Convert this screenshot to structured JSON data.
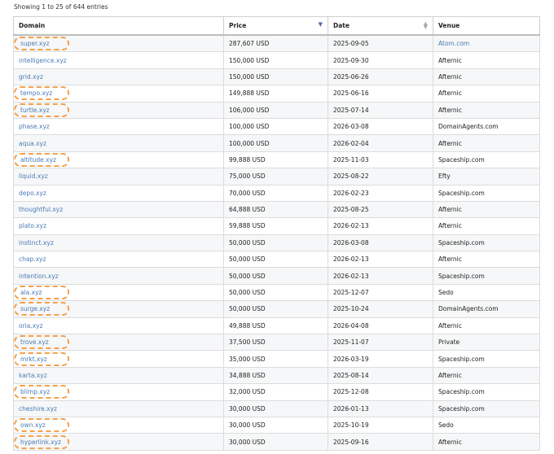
{
  "info": "Showing 1 to 25 of 644 entries",
  "columns": [
    "Domain",
    "Price",
    "Date",
    "Venue"
  ],
  "sort": {
    "column": "Price",
    "direction": "descending"
  },
  "rows": [
    {
      "domain": "super.xyz",
      "price": "287,607 USD",
      "date": "2025-09-05",
      "venue": "Atom.com",
      "venue_link": true,
      "highlighted": true
    },
    {
      "domain": "intelligence.xyz",
      "price": "150,000 USD",
      "date": "2025-09-30",
      "venue": "Afternic",
      "venue_link": false,
      "highlighted": false
    },
    {
      "domain": "grid.xyz",
      "price": "150,000 USD",
      "date": "2025-06-26",
      "venue": "Afternic",
      "venue_link": false,
      "highlighted": false
    },
    {
      "domain": "tempo.xyz",
      "price": "149,888 USD",
      "date": "2025-06-16",
      "venue": "Afternic",
      "venue_link": false,
      "highlighted": true
    },
    {
      "domain": "turtle.xyz",
      "price": "106,000 USD",
      "date": "2025-07-14",
      "venue": "Afternic",
      "venue_link": false,
      "highlighted": true
    },
    {
      "domain": "phase.xyz",
      "price": "100,000 USD",
      "date": "2026-03-08",
      "venue": "DomainAgents.com",
      "venue_link": false,
      "highlighted": false
    },
    {
      "domain": "aqua.xyz",
      "price": "100,000 USD",
      "date": "2026-02-04",
      "venue": "Afternic",
      "venue_link": false,
      "highlighted": false
    },
    {
      "domain": "altitude.xyz",
      "price": "99,888 USD",
      "date": "2025-11-03",
      "venue": "Spaceship.com",
      "venue_link": false,
      "highlighted": true
    },
    {
      "domain": "liquid.xyz",
      "price": "75,000 USD",
      "date": "2025-08-22",
      "venue": "Efty",
      "venue_link": false,
      "highlighted": false
    },
    {
      "domain": "depo.xyz",
      "price": "70,000 USD",
      "date": "2026-02-23",
      "venue": "Spaceship.com",
      "venue_link": false,
      "highlighted": false
    },
    {
      "domain": "thoughtful.xyz",
      "price": "64,888 USD",
      "date": "2025-08-25",
      "venue": "Afternic",
      "venue_link": false,
      "highlighted": false
    },
    {
      "domain": "plato.xyz",
      "price": "59,888 USD",
      "date": "2026-02-13",
      "venue": "Afternic",
      "venue_link": false,
      "highlighted": false
    },
    {
      "domain": "instinct.xyz",
      "price": "50,000 USD",
      "date": "2026-03-08",
      "venue": "Spaceship.com",
      "venue_link": false,
      "highlighted": false
    },
    {
      "domain": "chap.xyz",
      "price": "50,000 USD",
      "date": "2026-02-13",
      "venue": "Afternic",
      "venue_link": false,
      "highlighted": false
    },
    {
      "domain": "intention.xyz",
      "price": "50,000 USD",
      "date": "2026-02-13",
      "venue": "Spaceship.com",
      "venue_link": false,
      "highlighted": false
    },
    {
      "domain": "ala.xyz",
      "price": "50,000 USD",
      "date": "2025-12-07",
      "venue": "Sedo",
      "venue_link": false,
      "highlighted": true
    },
    {
      "domain": "surge.xyz",
      "price": "50,000 USD",
      "date": "2025-10-24",
      "venue": "DomainAgents.com",
      "venue_link": false,
      "highlighted": true
    },
    {
      "domain": "oria.xyz",
      "price": "49,888 USD",
      "date": "2026-04-08",
      "venue": "Afternic",
      "venue_link": false,
      "highlighted": false
    },
    {
      "domain": "trove.xyz",
      "price": "37,500 USD",
      "date": "2025-11-07",
      "venue": "Private",
      "venue_link": false,
      "highlighted": true
    },
    {
      "domain": "mrkt.xyz",
      "price": "35,000 USD",
      "date": "2026-03-19",
      "venue": "Spaceship.com",
      "venue_link": false,
      "highlighted": true
    },
    {
      "domain": "karta.xyz",
      "price": "34,888 USD",
      "date": "2025-08-14",
      "venue": "Afternic",
      "venue_link": false,
      "highlighted": false
    },
    {
      "domain": "blimp.xyz",
      "price": "32,000 USD",
      "date": "2025-12-08",
      "venue": "Spaceship.com",
      "venue_link": false,
      "highlighted": true
    },
    {
      "domain": "cheshire.xyz",
      "price": "30,000 USD",
      "date": "2026-01-13",
      "venue": "Spaceship.com",
      "venue_link": false,
      "highlighted": false
    },
    {
      "domain": "own.xyz",
      "price": "30,000 USD",
      "date": "2025-10-19",
      "venue": "Sedo",
      "venue_link": false,
      "highlighted": true
    },
    {
      "domain": "hyperlink.xyz",
      "price": "30,000 USD",
      "date": "2025-09-16",
      "venue": "Afternic",
      "venue_link": false,
      "highlighted": true
    }
  ],
  "colors": {
    "link": "#4a7ab5",
    "highlight": "#f5a04a",
    "stripe": "#f6f7f8"
  }
}
